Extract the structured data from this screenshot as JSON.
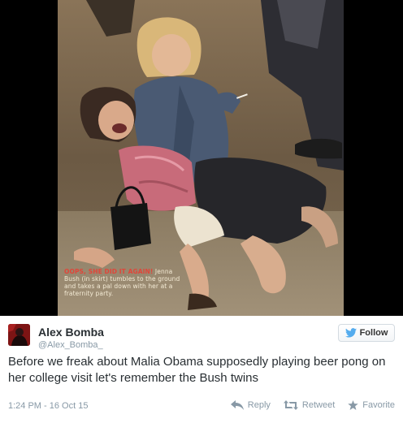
{
  "photo": {
    "caption_highlight": "OOPS, SHE DID IT AGAIN!",
    "caption_rest": " Jenna Bush (in skirt) tumbles to the ground and takes a pal down with her at a fraternity party."
  },
  "tweet": {
    "author": {
      "name": "Alex Bomba",
      "handle": "@Alex_Bomba_"
    },
    "follow_button": {
      "label": "Follow",
      "icon": "twitter-bird-icon"
    },
    "text": "Before we freak about Malia Obama supposedly playing beer pong on her college visit let's remember the Bush twins",
    "timestamp": "1:24 PM - 16 Oct 15",
    "actions": {
      "reply": {
        "label": "Reply",
        "icon": "reply-icon"
      },
      "retweet": {
        "label": "Retweet",
        "icon": "retweet-icon"
      },
      "favorite": {
        "label": "Favorite",
        "icon": "star-icon"
      }
    }
  },
  "colors": {
    "twitter_blue": "#55acee",
    "text": "#292f33",
    "muted": "#8899a6",
    "avatar_red": "#7d1414"
  }
}
